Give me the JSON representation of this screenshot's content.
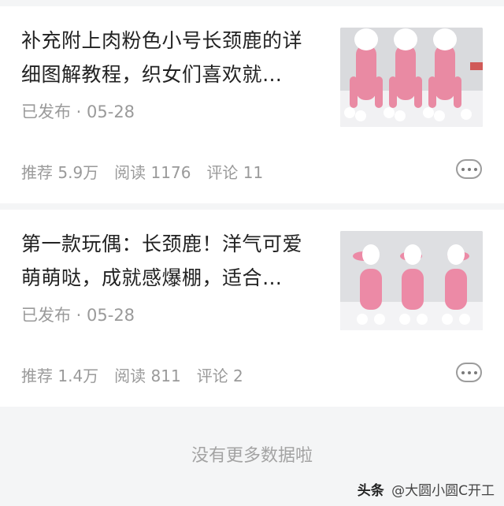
{
  "articles": [
    {
      "title": "补充附上肉粉色小号长颈鹿的详细图解教程，织女们喜欢就…",
      "meta": "已发布 · 05-28",
      "stats": {
        "recommend": "推荐 5.9万",
        "read": "阅读 1176",
        "comment": "评论 11"
      },
      "thumb_icon": "pink-giraffe-photo"
    },
    {
      "title": "第一款玩偶：长颈鹿！洋气可爱萌萌哒，成就感爆棚，适合…",
      "meta": "已发布 · 05-28",
      "stats": {
        "recommend": "推荐 1.4万",
        "read": "阅读 811",
        "comment": "评论 2"
      },
      "thumb_icon": "pink-giraffe-photo"
    }
  ],
  "footer": {
    "text": "没有更多数据啦"
  },
  "watermark": {
    "brand": "头条",
    "text": "@大圆小圆C开工"
  },
  "colors": {
    "pink": "#e7879f",
    "white": "#ffffff",
    "gray_text": "#9a9a9a"
  }
}
